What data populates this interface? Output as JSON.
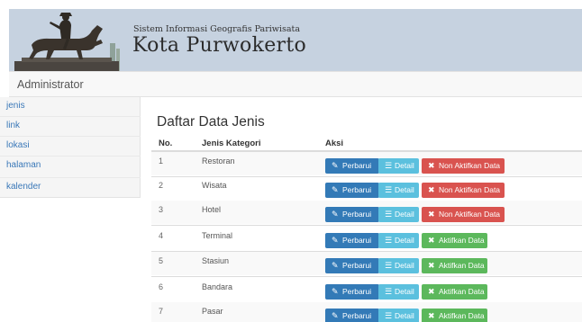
{
  "banner": {
    "subtitle": "Sistem Informasi Geografis Pariwisata",
    "title": "Kota Purwokerto"
  },
  "navbar": {
    "brand": "Administrator"
  },
  "sidebar": {
    "items": [
      {
        "label": "jenis"
      },
      {
        "label": "link"
      },
      {
        "label": "lokasi"
      },
      {
        "label": "halaman"
      },
      {
        "label": "kalender"
      }
    ]
  },
  "main": {
    "heading": "Daftar Data Jenis",
    "columns": [
      "No.",
      "Jenis Kategori",
      "Aksi"
    ],
    "rows": [
      {
        "no": "1",
        "name": "Restoran",
        "status_action": "Non Aktifkan Data"
      },
      {
        "no": "2",
        "name": "Wisata",
        "status_action": "Non Aktifkan Data"
      },
      {
        "no": "3",
        "name": "Hotel",
        "status_action": "Non Aktifkan Data"
      },
      {
        "no": "4",
        "name": "Terminal",
        "status_action": "Aktifkan Data"
      },
      {
        "no": "5",
        "name": "Stasiun",
        "status_action": "Aktifkan Data"
      },
      {
        "no": "6",
        "name": "Bandara",
        "status_action": "Aktifkan Data"
      },
      {
        "no": "7",
        "name": "Pasar",
        "status_action": "Aktifkan Data"
      }
    ],
    "actions": {
      "update_label": "Perbarui",
      "detail_label": "Detail",
      "update_icon": "edit-icon",
      "detail_icon": "list-icon",
      "status_icon": "trash-icon"
    }
  },
  "colors": {
    "banner_bg": "#c6d2e0",
    "primary": "#337ab7",
    "info": "#5bc0de",
    "danger": "#d9534f",
    "success": "#5cb85c",
    "link": "#3a78b8"
  }
}
